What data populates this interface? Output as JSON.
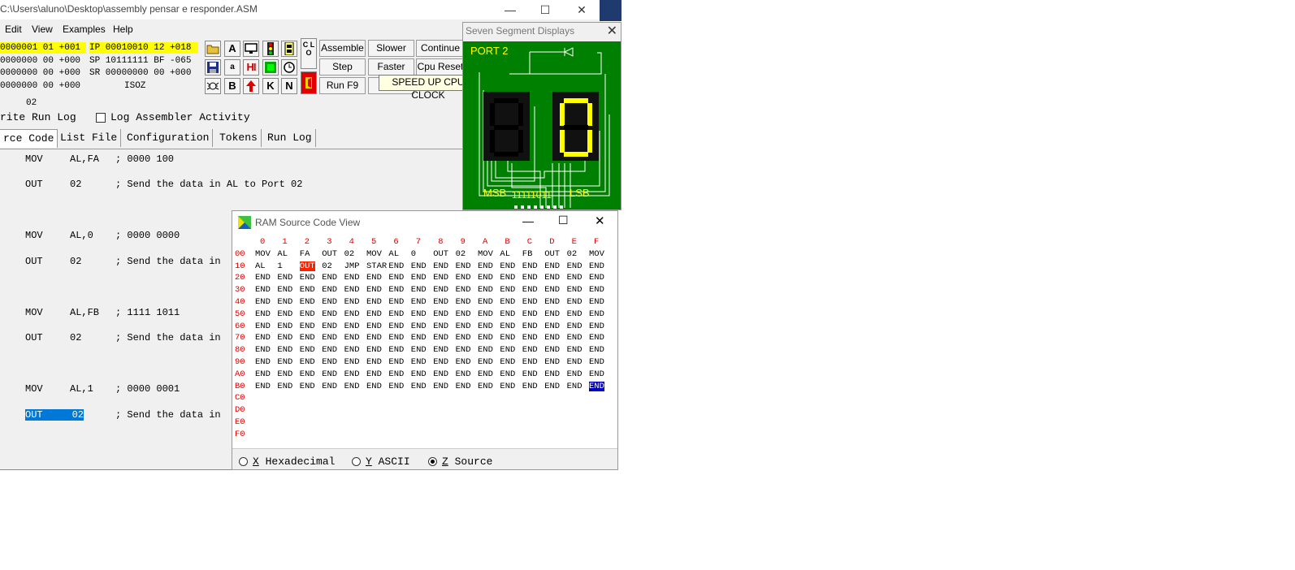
{
  "window": {
    "title": "C:\\Users\\aluno\\Desktop\\assembly pensar e responder.ASM",
    "min": "—",
    "max": "☐",
    "close": "✕"
  },
  "menu": [
    "Edit",
    "View",
    "Examples",
    "Help"
  ],
  "registers": {
    "left": [
      "0000001 01 +001",
      "0000000 00 +000",
      "0000000 00 +000",
      "0000000 00 +000"
    ],
    "ip": "IP 00010010 12 +018",
    "sp": "SP 10111111 BF -065",
    "sr": "SR 00000000 00 +000",
    "flags": "ISOZ",
    "port_value": "02"
  },
  "toolbar_icons": {
    "row1": [
      "open-icon",
      "A",
      "monitor-icon",
      "traffic-light-icon",
      "lift-icon"
    ],
    "row2": [
      "save-icon",
      "a",
      "HI",
      "green-matrix-icon",
      "clock-icon"
    ],
    "row3": [
      "bug-icon",
      "B",
      "up-arrow-icon",
      "K",
      "N"
    ],
    "clo": "C L O"
  },
  "controls": {
    "assemble": "Assemble",
    "slower": "Slower",
    "continue": "Continue",
    "step": "Step",
    "faster": "Faster",
    "cpu_reset": "Cpu Reset",
    "run": "Run F9"
  },
  "tooltip": "SPEED UP CPU CLOCK",
  "options": {
    "write_run_log": "rite Run Log",
    "log_assembler": "Log Assembler Activity"
  },
  "tabs": [
    "rce Code",
    "List File",
    "Configuration",
    "Tokens",
    "Run Log"
  ],
  "source": [
    {
      "op": "MOV",
      "arg": "AL,FA",
      "comment": "; 0000 100"
    },
    {
      "op": "OUT",
      "arg": "02",
      "comment": "; Send the data in AL to Port 02"
    },
    {
      "op": "MOV",
      "arg": "AL,0",
      "comment": "; 0000 0000"
    },
    {
      "op": "OUT",
      "arg": "02",
      "comment": "; Send the data in"
    },
    {
      "op": "MOV",
      "arg": "AL,FB",
      "comment": "; 1111 1011"
    },
    {
      "op": "OUT",
      "arg": "02",
      "comment": "; Send the data in"
    },
    {
      "op": "MOV",
      "arg": "AL,1",
      "comment": "; 0000 0001"
    },
    {
      "op": "OUT",
      "arg": "02",
      "comment": "; Send the data in"
    }
  ],
  "selected_line": "OUT     02",
  "seven_segment": {
    "title": "Seven Segment Displays",
    "port": "PORT 2",
    "msb": "MSB",
    "lsb": "LSB",
    "bits": "11111011",
    "display_color": "#ffff00",
    "board_color": "#008000"
  },
  "ram": {
    "title": "RAM Source Code View",
    "columns": [
      "0",
      "1",
      "2",
      "3",
      "4",
      "5",
      "6",
      "7",
      "8",
      "9",
      "A",
      "B",
      "C",
      "D",
      "E",
      "F"
    ],
    "rows": [
      {
        "addr": "00",
        "cells": [
          "MOV",
          "AL",
          "FA",
          "OUT",
          "02",
          "MOV",
          "AL",
          "0",
          "OUT",
          "02",
          "MOV",
          "AL",
          "FB",
          "OUT",
          "02",
          "MOV"
        ]
      },
      {
        "addr": "10",
        "cells": [
          "AL",
          "1",
          "OUT",
          "02",
          "JMP",
          "STAR",
          "END",
          "END",
          "END",
          "END",
          "END",
          "END",
          "END",
          "END",
          "END",
          "END"
        ]
      },
      {
        "addr": "20",
        "cells": [
          "END",
          "END",
          "END",
          "END",
          "END",
          "END",
          "END",
          "END",
          "END",
          "END",
          "END",
          "END",
          "END",
          "END",
          "END",
          "END"
        ]
      },
      {
        "addr": "30",
        "cells": [
          "END",
          "END",
          "END",
          "END",
          "END",
          "END",
          "END",
          "END",
          "END",
          "END",
          "END",
          "END",
          "END",
          "END",
          "END",
          "END"
        ]
      },
      {
        "addr": "40",
        "cells": [
          "END",
          "END",
          "END",
          "END",
          "END",
          "END",
          "END",
          "END",
          "END",
          "END",
          "END",
          "END",
          "END",
          "END",
          "END",
          "END"
        ]
      },
      {
        "addr": "50",
        "cells": [
          "END",
          "END",
          "END",
          "END",
          "END",
          "END",
          "END",
          "END",
          "END",
          "END",
          "END",
          "END",
          "END",
          "END",
          "END",
          "END"
        ]
      },
      {
        "addr": "60",
        "cells": [
          "END",
          "END",
          "END",
          "END",
          "END",
          "END",
          "END",
          "END",
          "END",
          "END",
          "END",
          "END",
          "END",
          "END",
          "END",
          "END"
        ]
      },
      {
        "addr": "70",
        "cells": [
          "END",
          "END",
          "END",
          "END",
          "END",
          "END",
          "END",
          "END",
          "END",
          "END",
          "END",
          "END",
          "END",
          "END",
          "END",
          "END"
        ]
      },
      {
        "addr": "80",
        "cells": [
          "END",
          "END",
          "END",
          "END",
          "END",
          "END",
          "END",
          "END",
          "END",
          "END",
          "END",
          "END",
          "END",
          "END",
          "END",
          "END"
        ]
      },
      {
        "addr": "90",
        "cells": [
          "END",
          "END",
          "END",
          "END",
          "END",
          "END",
          "END",
          "END",
          "END",
          "END",
          "END",
          "END",
          "END",
          "END",
          "END",
          "END"
        ]
      },
      {
        "addr": "A0",
        "cells": [
          "END",
          "END",
          "END",
          "END",
          "END",
          "END",
          "END",
          "END",
          "END",
          "END",
          "END",
          "END",
          "END",
          "END",
          "END",
          "END"
        ]
      },
      {
        "addr": "B0",
        "cells": [
          "END",
          "END",
          "END",
          "END",
          "END",
          "END",
          "END",
          "END",
          "END",
          "END",
          "END",
          "END",
          "END",
          "END",
          "END",
          "END"
        ]
      },
      {
        "addr": "C0",
        "cells": []
      },
      {
        "addr": "D0",
        "cells": []
      },
      {
        "addr": "E0",
        "cells": []
      },
      {
        "addr": "F0",
        "cells": []
      }
    ],
    "highlight_ip": {
      "row": 1,
      "col": 2,
      "color": "#ff2000"
    },
    "highlight_sp": {
      "row": 11,
      "col": 15,
      "color": "#0000c0"
    },
    "view_options": [
      {
        "key": "X",
        "label": "Hexadecimal",
        "selected": false
      },
      {
        "key": "Y",
        "label": "ASCII",
        "selected": false
      },
      {
        "key": "Z",
        "label": "Source",
        "selected": true
      }
    ]
  }
}
